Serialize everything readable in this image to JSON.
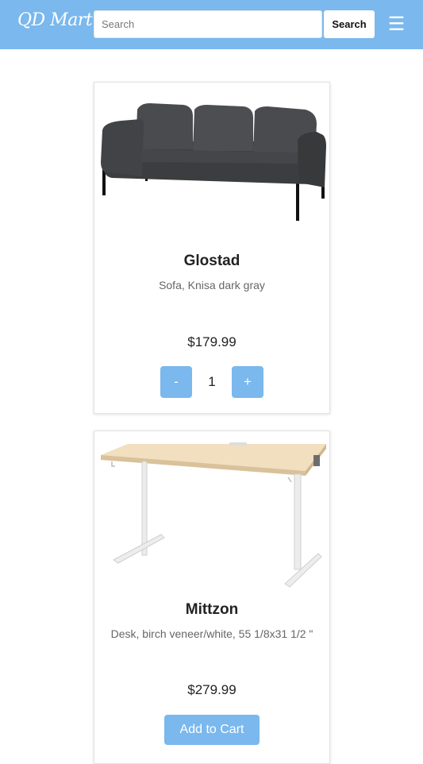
{
  "header": {
    "logo_text": "QD Mart",
    "search_placeholder": "Search",
    "search_button_label": "Search",
    "menu_icon": "hamburger-menu-icon",
    "brand_color": "#7ab8ee"
  },
  "products": [
    {
      "name": "Glostad",
      "description": "Sofa, Knisa dark gray",
      "price": "$179.99",
      "quantity": "1",
      "decrement_label": "-",
      "increment_label": "+",
      "image_icon": "sofa-image"
    },
    {
      "name": "Mittzon",
      "description": "Desk, birch veneer/white, 55 1/8x31 1/2 \"",
      "price": "$279.99",
      "add_to_cart_label": "Add to Cart",
      "image_icon": "desk-image"
    }
  ]
}
